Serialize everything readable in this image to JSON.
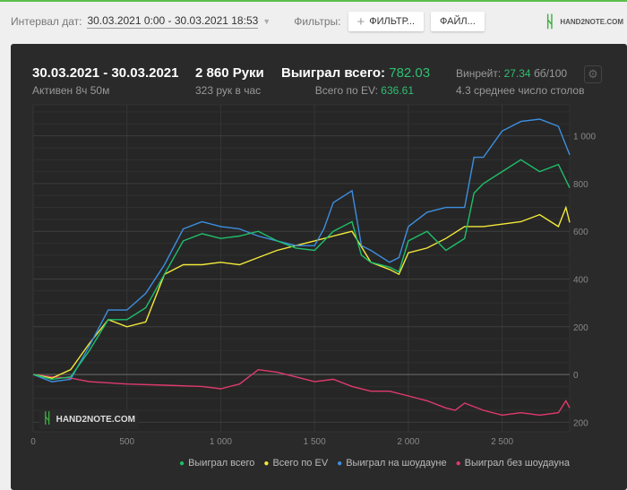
{
  "toolbar": {
    "interval_label": "Интервал дат:",
    "interval_value": "30.03.2021 0:00 - 30.03.2021 18:53",
    "filters_label": "Фильтры:",
    "filter_button": "ФИЛЬТР...",
    "files_button": "ФАЙЛ...",
    "logo": "HAND2NOTE.COM"
  },
  "summary": {
    "date_range": "30.03.2021 - 30.03.2021",
    "active": "Активен 8ч 50м",
    "hands": "2 860 Руки",
    "hands_per_hour": "323 рук в час",
    "won_label": "Выиграл всего:",
    "won_value": "782.03",
    "ev_label": "Всего по EV:",
    "ev_value": "636.61",
    "winrate_label": "Винрейт:",
    "winrate_value": "27.34",
    "winrate_unit": "бб/100",
    "tables": "4.3 среднее число столов"
  },
  "chart_data": {
    "type": "line",
    "xlim": [
      0,
      2860
    ],
    "ylim": [
      -240,
      1130
    ],
    "x_ticks": [
      0,
      500,
      1000,
      1500,
      2000,
      2500
    ],
    "x_tick_labels": [
      "0",
      "500",
      "1 000",
      "1 500",
      "2 000",
      "2 500"
    ],
    "y_ticks": [
      1000,
      800,
      600,
      400,
      200,
      0,
      -200
    ],
    "y_tick_labels": [
      "1 000",
      "800",
      "600",
      "400",
      "200",
      "0",
      "200"
    ],
    "grid": true,
    "legend": "bottom-right",
    "watermark": "HAND2NOTE.COM",
    "series": [
      {
        "name": "Выиграл всего",
        "color": "#1fbf6a",
        "x": [
          0,
          100,
          200,
          300,
          400,
          500,
          600,
          700,
          800,
          900,
          1000,
          1100,
          1200,
          1300,
          1400,
          1500,
          1600,
          1700,
          1750,
          1800,
          1900,
          1950,
          2000,
          2100,
          2200,
          2300,
          2350,
          2400,
          2500,
          2600,
          2700,
          2800,
          2860
        ],
        "y": [
          0,
          -20,
          -10,
          100,
          230,
          230,
          280,
          420,
          560,
          590,
          570,
          580,
          600,
          560,
          530,
          520,
          600,
          640,
          500,
          470,
          450,
          430,
          560,
          600,
          520,
          570,
          760,
          800,
          850,
          900,
          850,
          880,
          782
        ]
      },
      {
        "name": "Всего по EV",
        "color": "#f2e93a",
        "x": [
          0,
          100,
          200,
          300,
          400,
          500,
          600,
          700,
          800,
          900,
          1000,
          1100,
          1200,
          1300,
          1400,
          1500,
          1600,
          1700,
          1800,
          1900,
          1950,
          2000,
          2100,
          2200,
          2300,
          2400,
          2500,
          2600,
          2700,
          2800,
          2840,
          2860
        ],
        "y": [
          0,
          -15,
          20,
          130,
          230,
          200,
          220,
          420,
          460,
          460,
          470,
          460,
          490,
          520,
          540,
          560,
          580,
          600,
          470,
          440,
          420,
          510,
          530,
          570,
          620,
          620,
          630,
          640,
          670,
          620,
          700,
          637
        ]
      },
      {
        "name": "Выиграл на шоудауне",
        "color": "#3d8fe0",
        "x": [
          0,
          100,
          200,
          300,
          400,
          500,
          600,
          700,
          800,
          900,
          1000,
          1100,
          1200,
          1300,
          1400,
          1500,
          1550,
          1600,
          1700,
          1750,
          1800,
          1900,
          1950,
          2000,
          2100,
          2200,
          2300,
          2350,
          2400,
          2500,
          2600,
          2700,
          2800,
          2860
        ],
        "y": [
          0,
          -30,
          -20,
          120,
          270,
          270,
          340,
          460,
          610,
          640,
          620,
          610,
          580,
          560,
          540,
          540,
          610,
          720,
          770,
          540,
          520,
          470,
          490,
          620,
          680,
          700,
          700,
          910,
          910,
          1020,
          1060,
          1070,
          1040,
          920
        ]
      },
      {
        "name": "Выиграл без шоудауна",
        "color": "#e03a6e",
        "x": [
          0,
          100,
          200,
          300,
          500,
          700,
          900,
          1000,
          1100,
          1200,
          1300,
          1400,
          1500,
          1600,
          1700,
          1800,
          1900,
          2000,
          2100,
          2200,
          2250,
          2300,
          2400,
          2500,
          2600,
          2700,
          2800,
          2840,
          2860
        ],
        "y": [
          0,
          -10,
          -15,
          -30,
          -40,
          -45,
          -50,
          -60,
          -40,
          20,
          10,
          -10,
          -30,
          -20,
          -50,
          -70,
          -70,
          -90,
          -110,
          -140,
          -150,
          -120,
          -150,
          -170,
          -160,
          -170,
          -160,
          -110,
          -140
        ]
      }
    ]
  },
  "settings_icon": "gear-icon"
}
